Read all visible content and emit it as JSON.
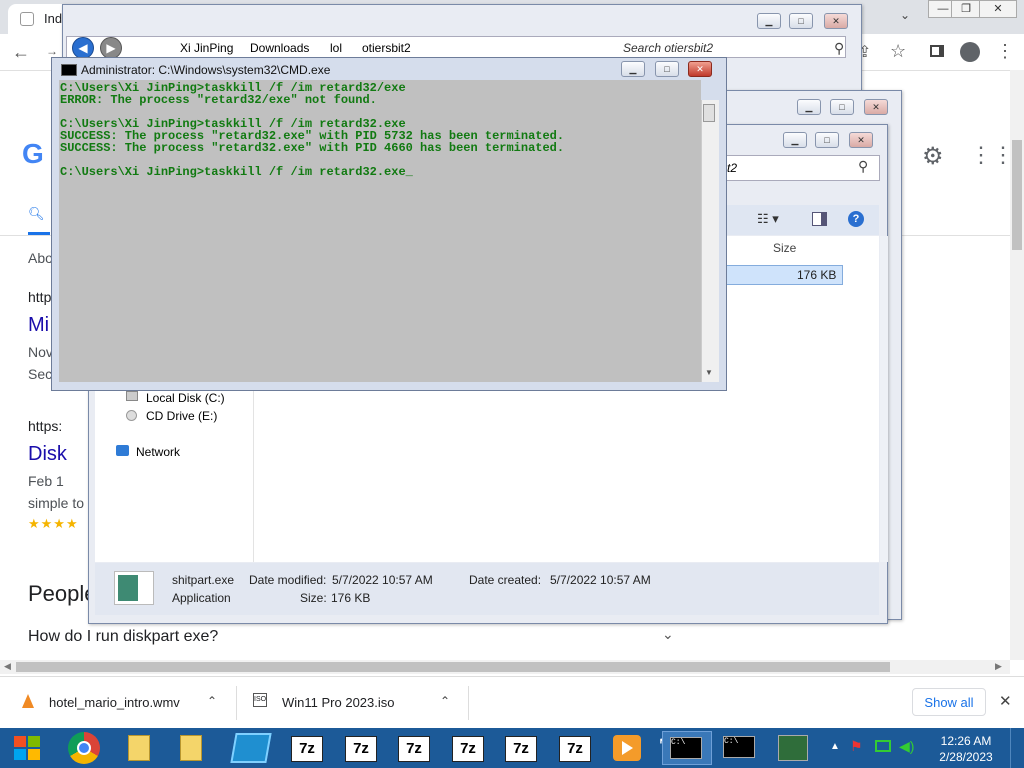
{
  "browser": {
    "tab_title": "Ind",
    "window_controls": {
      "minimize": "—",
      "restore": "❐",
      "close": "✕"
    },
    "google_logo": "G",
    "search_tab_label": "",
    "about_text": "Abo",
    "results": [
      {
        "url": "http",
        "title": "Mi",
        "date": "Nov",
        "snippet": "Sec"
      },
      {
        "url": "https:",
        "title": "Disk",
        "date": "Feb 1",
        "snippet": "simple to",
        "stars": "★★★★"
      }
    ],
    "people_also_ask": "People",
    "faq_question": "How do I run diskpart exe?"
  },
  "downloads": {
    "items": [
      {
        "name": "hotel_mario_intro.wmv",
        "icon": "vlc-cone-icon"
      },
      {
        "name": "Win11 Pro 2023.iso",
        "icon": "disc-image-icon"
      }
    ],
    "show_all": "Show all"
  },
  "explorer_back": {
    "breadcrumb": [
      "Xi JinPing",
      "Downloads",
      "lol",
      "otiersbit2"
    ],
    "search_placeholder": "Search otiersbit2"
  },
  "explorer_front": {
    "search_fragment": "t2",
    "column_size": "Size",
    "file_size": "176 KB",
    "nav_items": [
      "Local Disk (C:)",
      "CD Drive (E:)",
      "Network"
    ],
    "status": {
      "filename": "shitpart.exe",
      "type": "Application",
      "date_modified_label": "Date modified:",
      "date_modified": "5/7/2022 10:57 AM",
      "date_created_label": "Date created:",
      "date_created": "5/7/2022 10:57 AM",
      "size_label": "Size:",
      "size": "176 KB"
    }
  },
  "cmd": {
    "title": "Administrator: C:\\Windows\\system32\\CMD.exe",
    "lines": [
      "C:\\Users\\Xi JinPing>taskkill /f /im retard32/exe",
      "ERROR: The process \"retard32/exe\" not found.",
      "",
      "C:\\Users\\Xi JinPing>taskkill /f /im retard32.exe",
      "SUCCESS: The process \"retard32.exe\" with PID 5732 has been terminated.",
      "SUCCESS: The process \"retard32.exe\" with PID 4660 has been terminated.",
      "",
      "C:\\Users\\Xi JinPing>taskkill /f /im retard32.exe_"
    ],
    "text_color": "#117a11"
  },
  "taskbar": {
    "seven_zip_label": "7z",
    "cmd_label": "C:\\",
    "time": "12:26 AM",
    "date": "2/28/2023"
  }
}
